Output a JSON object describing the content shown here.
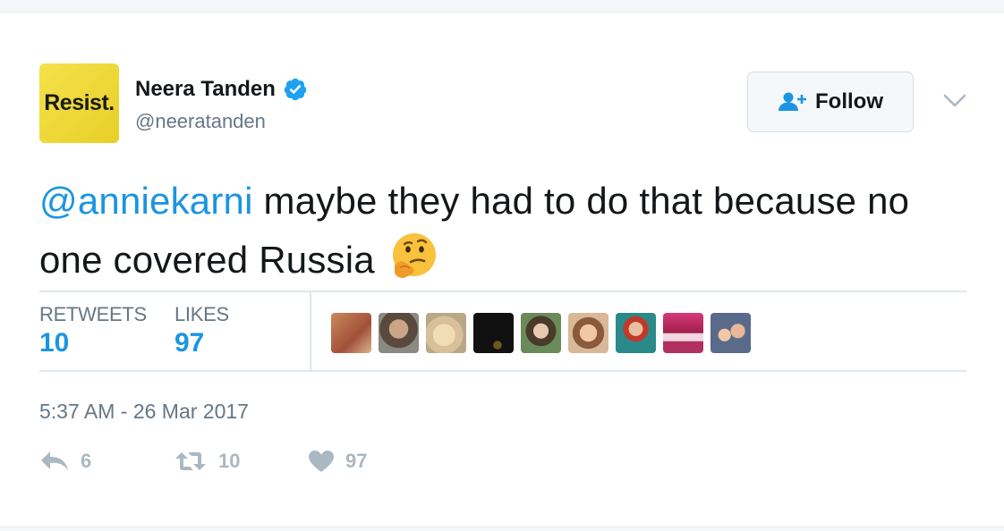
{
  "author": {
    "avatar_text": "Resist.",
    "fullname": "Neera Tanden",
    "username": "@neeratanden",
    "verified": true
  },
  "follow_button": {
    "label": "Follow"
  },
  "tweet": {
    "mention": "@anniekarni",
    "text": " maybe they had to do that because no one covered Russia",
    "emoji": "thinking-face"
  },
  "stats": {
    "retweets_label": "RETWEETS",
    "retweets_value": "10",
    "likes_label": "LIKES",
    "likes_value": "97",
    "liker_avatar_count": 9
  },
  "timestamp": "5:37 AM - 26 Mar 2017",
  "actions": {
    "reply_count": "6",
    "retweet_count": "10",
    "like_count": "97"
  },
  "colors": {
    "link": "#1b95e0",
    "muted": "#657786",
    "action_gray": "#aab8c2",
    "avatar_yellow": "#f4e24a"
  }
}
